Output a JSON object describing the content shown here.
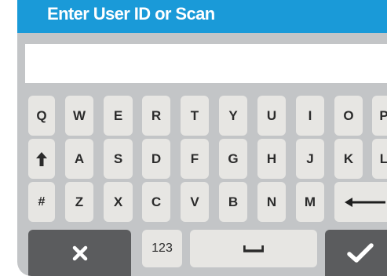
{
  "header": {
    "title": "Enter User ID or Scan"
  },
  "input": {
    "value": "",
    "placeholder": ""
  },
  "keyboard": {
    "row1": [
      "Q",
      "W",
      "E",
      "R",
      "T",
      "Y",
      "U",
      "I",
      "O",
      "P"
    ],
    "row2": [
      "A",
      "S",
      "D",
      "F",
      "G",
      "H",
      "J",
      "K",
      "L"
    ],
    "row3": [
      "Z",
      "X",
      "C",
      "V",
      "B",
      "N",
      "M"
    ],
    "shift_icon": "up-arrow-icon",
    "symbols_label": "#",
    "backspace_icon": "left-arrow-icon",
    "cancel_icon": "x-icon",
    "numbers_label": "123",
    "space_icon": "space-bar-icon",
    "confirm_icon": "checkmark-icon"
  },
  "colors": {
    "title_bar": "#1a9ad8",
    "keyboard_background": "#c3c5c7",
    "key": "#e7e6e3",
    "action_key": "#5b5c5e"
  }
}
